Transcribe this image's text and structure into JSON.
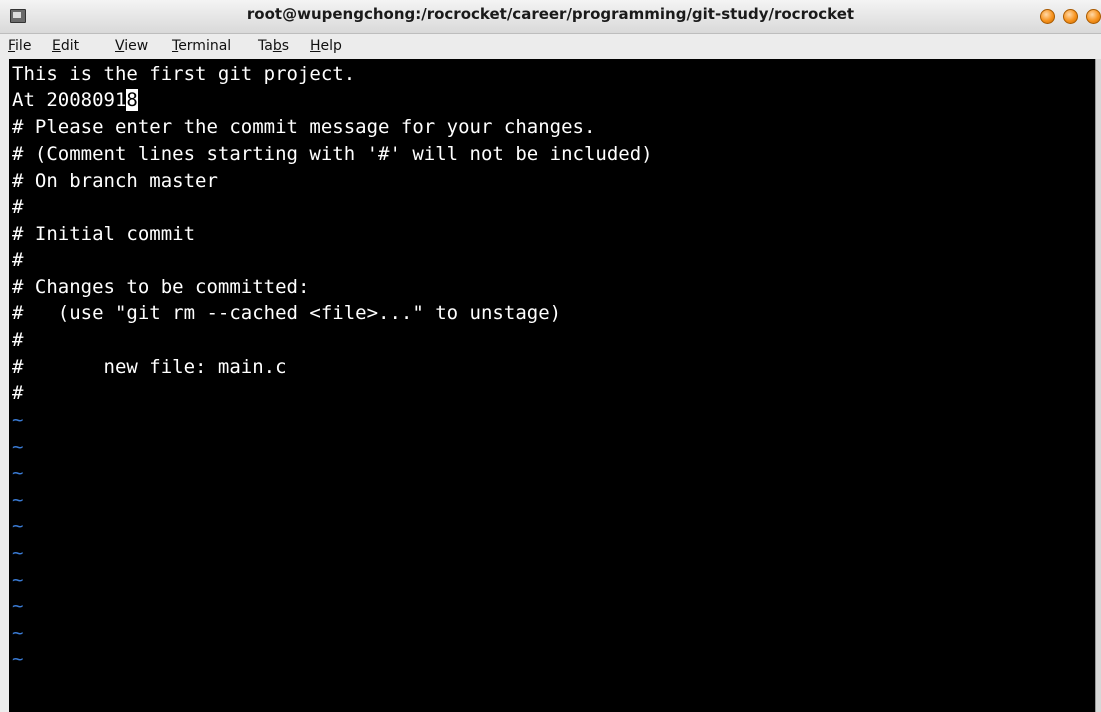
{
  "window": {
    "title": "root@wupengchong:/rocrocket/career/programming/git-study/rocrocket",
    "icon": "terminal-icon"
  },
  "menu": [
    {
      "before": "",
      "mnemonic": "F",
      "after": "ile"
    },
    {
      "before": "",
      "mnemonic": "E",
      "after": "dit"
    },
    {
      "before": "",
      "mnemonic": "V",
      "after": "iew"
    },
    {
      "before": "",
      "mnemonic": "T",
      "after": "erminal"
    },
    {
      "before": "Ta",
      "mnemonic": "b",
      "after": "s"
    },
    {
      "before": "",
      "mnemonic": "H",
      "after": "elp"
    }
  ],
  "terminal": {
    "lines": [
      "This is the first git project.",
      "At 2008091",
      "# Please enter the commit message for your changes.",
      "# (Comment lines starting with '#' will not be included)",
      "# On branch master",
      "#",
      "# Initial commit",
      "#",
      "# Changes to be committed:",
      "#   (use \"git rm --cached <file>...\" to unstage)",
      "#",
      "#       new file: main.c",
      "#"
    ],
    "cursor_char": "8",
    "tilde": "~",
    "tilde_count": 10
  },
  "colors": {
    "background": "#000000",
    "text": "#ffffff",
    "tilde": "#3a7bd5",
    "window_button": "#f7931e"
  }
}
